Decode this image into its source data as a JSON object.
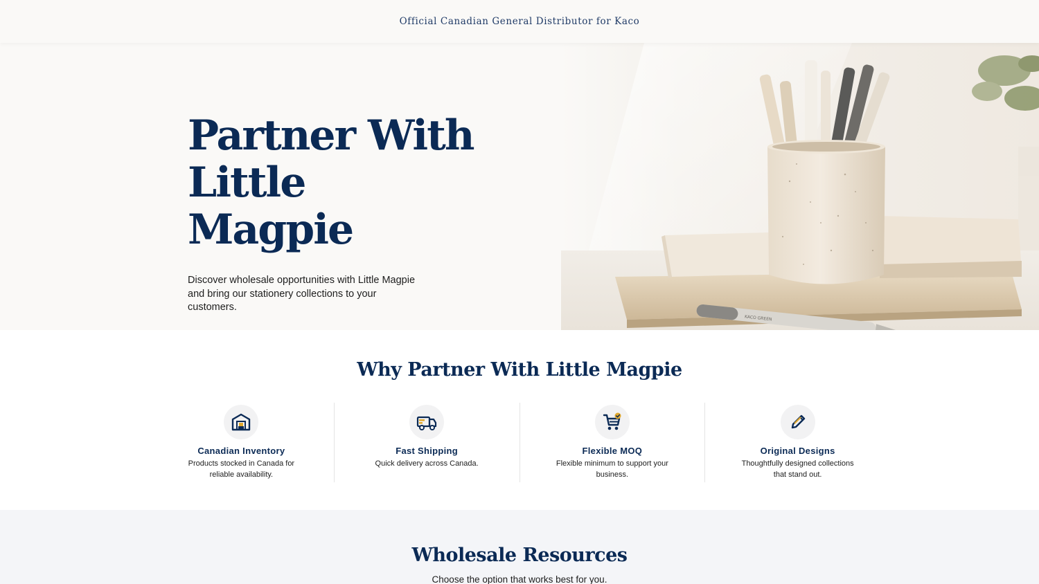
{
  "announcement": "Official Canadian General Distributor for Kaco",
  "hero": {
    "title_line1": "Partner With",
    "title_line2": "Little Magpie",
    "subtitle": "Discover wholesale opportunities with Little Magpie and bring our stationery collections to your customers.",
    "image_pen_label": "KACO GREEN"
  },
  "why": {
    "title": "Why Partner With Little Magpie",
    "features": [
      {
        "icon": "warehouse-icon",
        "name": "Canadian Inventory",
        "desc": "Products stocked in Canada for reliable availability."
      },
      {
        "icon": "delivery-truck-icon",
        "name": "Fast Shipping",
        "desc": "Quick delivery across Canada."
      },
      {
        "icon": "shopping-cart-check-icon",
        "name": "Flexible MOQ",
        "desc": "Flexible minimum to support your business."
      },
      {
        "icon": "pencil-icon",
        "name": "Original Designs",
        "desc": "Thoughtfully designed collections that stand out."
      }
    ]
  },
  "resources": {
    "title": "Wholesale Resources",
    "subtitle": "Choose the option that works best for you."
  },
  "colors": {
    "navy": "#0b2a55",
    "accent_gold": "#e0a82e",
    "hero_bg": "#faf9f7",
    "resources_bg": "#f4f5f8"
  }
}
